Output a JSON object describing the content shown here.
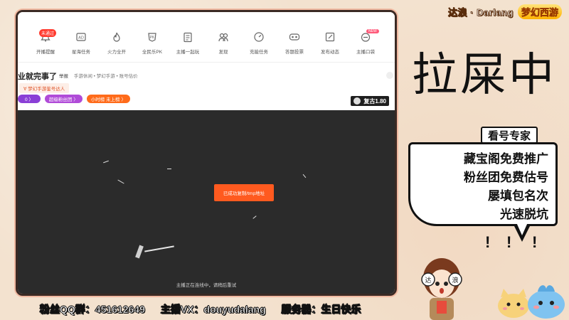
{
  "brand": {
    "streamer": "达浪 · Darlang",
    "game_logo": "梦幻西游"
  },
  "toolbar": {
    "items": [
      {
        "label": "开播提醒",
        "icon": "bell-icon",
        "badge": "未通过"
      },
      {
        "label": "星海任务",
        "icon": "ad-icon"
      },
      {
        "label": "火力全开",
        "icon": "flame-icon"
      },
      {
        "label": "全民乐PK",
        "icon": "pk-icon"
      },
      {
        "label": "主播一起玩",
        "icon": "clipboard-icon"
      },
      {
        "label": "发现",
        "icon": "people-icon"
      },
      {
        "label": "充能任务",
        "icon": "gauge-icon"
      },
      {
        "label": "答题投票",
        "icon": "vote-icon"
      },
      {
        "label": "发布动态",
        "icon": "edit-icon"
      },
      {
        "label": "主播口袋",
        "icon": "pocket-icon",
        "badge": "NEW"
      }
    ]
  },
  "room": {
    "title": "业就完事了",
    "meta_tag": "举报",
    "breadcrumb": "手游休闲 • 梦幻手游 • 账号估价",
    "anchor_tag": "∀ 梦幻手游鉴号达人",
    "pills": [
      "0 〉",
      "超级粉丝团 〉",
      "小时榜 未上榜 〉"
    ],
    "game_badge": "复古1.80"
  },
  "player": {
    "copy_button": "已成功复制/tmp地址",
    "reconnect_text": "主播正在连线中，请稍后重试"
  },
  "status_big": "拉屎中",
  "bubble": {
    "title": "看号专家",
    "lines": [
      "藏宝阁免费推广",
      "粉丝团免费估号",
      "屡填包名次",
      "光速脱坑"
    ]
  },
  "footer": {
    "qq": "粉丝QQ群：451612649",
    "vx": "主播VX：douyudalang",
    "server": "服务器：生日快乐"
  }
}
